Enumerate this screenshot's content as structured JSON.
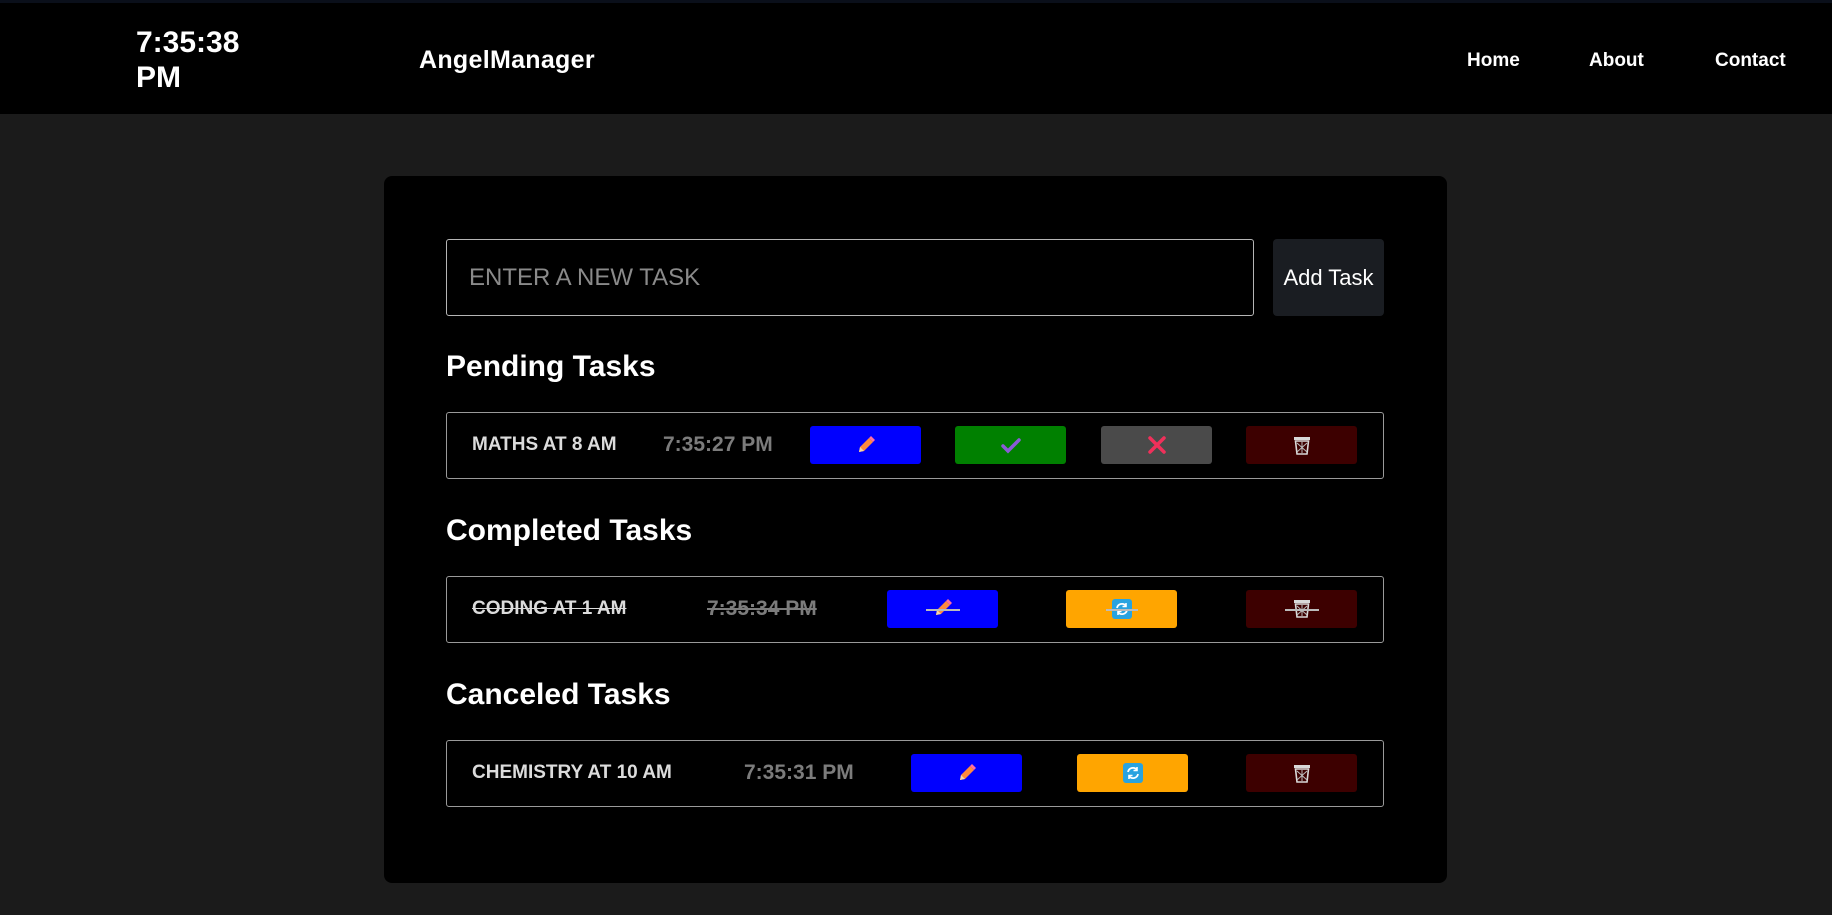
{
  "header": {
    "clock": "7:35:38 PM",
    "brand": "AngelManager",
    "nav": [
      "Home",
      "About",
      "Contact"
    ]
  },
  "form": {
    "placeholder": "ENTER A NEW TASK",
    "value": "",
    "add_label": "Add Task"
  },
  "sections": {
    "pending": {
      "title": "Pending Tasks",
      "tasks": [
        {
          "name": "MATHS AT 8 AM",
          "time": "7:35:27 PM",
          "actions": [
            "edit-icon",
            "check-icon",
            "x-icon",
            "trash-icon"
          ]
        }
      ]
    },
    "completed": {
      "title": "Completed Tasks",
      "tasks": [
        {
          "name": "CODING AT 1 AM",
          "time": "7:35:34 PM",
          "actions": [
            "edit-icon",
            "restore-icon",
            "trash-icon"
          ]
        }
      ]
    },
    "canceled": {
      "title": "Canceled Tasks",
      "tasks": [
        {
          "name": "CHEMISTRY AT 10 AM",
          "time": "7:35:31 PM",
          "actions": [
            "edit-icon",
            "restore-icon",
            "trash-icon"
          ]
        }
      ]
    }
  },
  "colors": {
    "edit": "#0000ff",
    "done": "#008000",
    "cancel": "#4a4a4a",
    "delete": "#3d0000",
    "restore": "#ffa500",
    "page_bg": "#1b1b1b",
    "panel_bg": "#000000"
  }
}
